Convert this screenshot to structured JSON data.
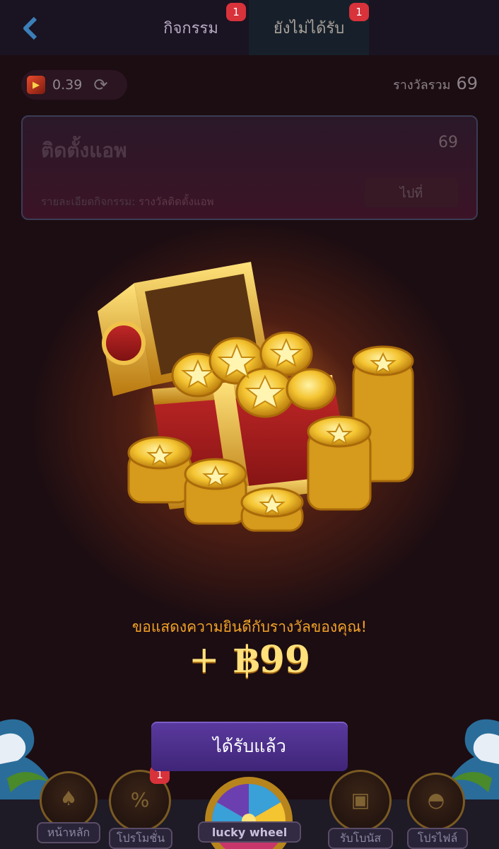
{
  "header": {
    "tabs": [
      {
        "label": "กิจกรรม",
        "badge": "1"
      },
      {
        "label": "ยังไม่ได้รับ",
        "badge": "1"
      }
    ]
  },
  "summary": {
    "balance": "0.39",
    "total_label": "รางวัลรวม",
    "total_value": "69"
  },
  "task": {
    "title": "ติดตั้งแอพ",
    "reward": "69",
    "detail_label": "รายละเอียดกิจกรรม:",
    "detail_value": "รางวัลติดตั้งแอพ",
    "go_label": "ไปที่"
  },
  "reward_modal": {
    "message": "ขอแสดงความยินดีกับรางวัลของคุณ!",
    "plus": "+",
    "amount": "฿99",
    "claim_label": "ได้รับแล้ว"
  },
  "bottom_nav": {
    "items": [
      {
        "label": "หน้าหลัก",
        "icon": "spade-icon"
      },
      {
        "label": "โปรโมชั่น",
        "icon": "percent-ticket-icon",
        "badge": "1"
      },
      {
        "label": "lucky wheel",
        "icon": "wheel-icon"
      },
      {
        "label": "รับโบนัส",
        "icon": "gift-icon"
      },
      {
        "label": "โปรไฟล์",
        "icon": "profile-icon"
      }
    ]
  },
  "colors": {
    "accent_purple": "#4a2f8c",
    "gold": "#ffe07a",
    "orange_text": "#f2a227",
    "badge_red": "#d8323b"
  }
}
